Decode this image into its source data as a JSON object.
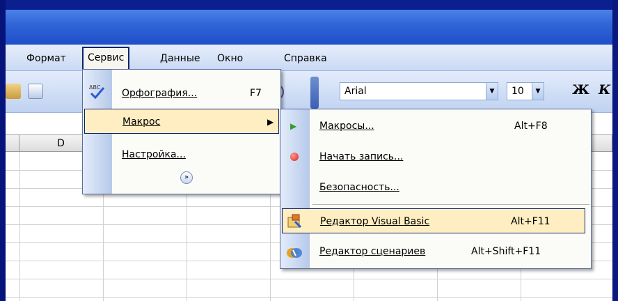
{
  "menubar": {
    "items": [
      {
        "label": "Формат"
      },
      {
        "label": "Сервис"
      },
      {
        "label": "Данные"
      },
      {
        "label": "Окно"
      },
      {
        "label": "Справка"
      }
    ]
  },
  "toolbar": {
    "font_name": "Arial",
    "font_size": "10",
    "bold_label": "Ж",
    "italic_label": "К"
  },
  "sheet": {
    "column_header": "D"
  },
  "service_menu": {
    "items": [
      {
        "label": "Орфография...",
        "shortcut": "F7",
        "icon": "spelling-abc-icon"
      },
      {
        "label": "Макрос",
        "icon": "none",
        "has_submenu": true
      },
      {
        "label": "Настройка...",
        "icon": "none"
      }
    ],
    "expand_icon": "chevron-double-down-icon"
  },
  "macro_submenu": {
    "items": [
      {
        "label": "Макросы...",
        "shortcut": "Alt+F8",
        "icon": "play-triangle-icon"
      },
      {
        "label": "Начать запись...",
        "shortcut": "",
        "icon": "record-dot-icon"
      },
      {
        "label": "Безопасность...",
        "shortcut": "",
        "icon": "none"
      },
      {
        "label": "Редактор Visual Basic",
        "shortcut": "Alt+F11",
        "icon": "vb-editor-icon"
      },
      {
        "label": "Редактор сценариев",
        "shortcut": "Alt+Shift+F11",
        "icon": "script-editor-icon"
      }
    ]
  },
  "colors": {
    "background": "#0b1f8f",
    "titlebar": "#2f63d6",
    "highlight": "#ffeec2",
    "highlight_border": "#0a246a"
  }
}
